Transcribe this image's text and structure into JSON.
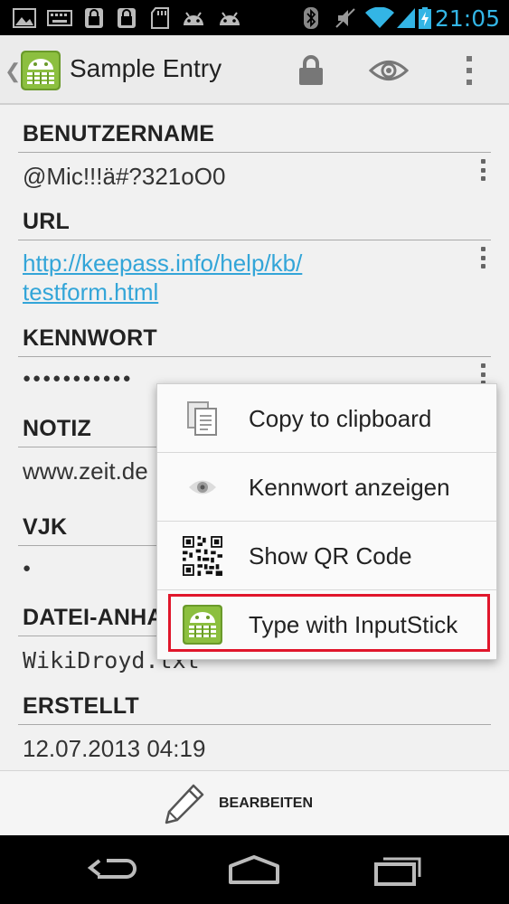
{
  "status_bar": {
    "time": "21:05",
    "left_icons": [
      "image-icon",
      "keyboard-icon",
      "lock-icon",
      "lock-icon",
      "sdcard-icon",
      "android-icon",
      "android-icon"
    ],
    "right_icons": [
      "bluetooth-icon",
      "vibrate-off-icon",
      "wifi-icon",
      "signal-icon",
      "battery-charging-icon"
    ],
    "accent_color": "#33b5e5"
  },
  "action_bar": {
    "title": "Sample Entry",
    "actions": [
      "lock-icon",
      "eye-icon",
      "overflow-menu-icon"
    ]
  },
  "fields": [
    {
      "title": "BENUTZERNAME",
      "value": "@Mic!!!ä#?321oO0"
    },
    {
      "title": "URL",
      "link_line1": "http://keepass.info/help/kb/",
      "link_line2": "testform.html"
    },
    {
      "title": "KENNWORT",
      "value": "●●●●●●●●●●●"
    },
    {
      "title": "NOTIZ",
      "value": "www.zeit.de"
    },
    {
      "title": "VJK",
      "value": "●"
    },
    {
      "title": "DATEI-ANHA",
      "value": "WikiDroyd.txt"
    },
    {
      "title": "ERSTELLT",
      "value": "12.07.2013 04:19"
    }
  ],
  "popup_menu": {
    "items": [
      {
        "label": "Copy to clipboard",
        "icon": "copy-icon"
      },
      {
        "label": "Kennwort anzeigen",
        "icon": "eye-icon"
      },
      {
        "label": "Show QR Code",
        "icon": "qr-code-icon"
      },
      {
        "label": "Type with InputStick",
        "icon": "inputstick-icon",
        "highlighted": true
      }
    ],
    "highlight_color": "#e0162b"
  },
  "edit_bar": {
    "label": "BEARBEITEN",
    "icon": "pencil-icon"
  },
  "nav_bar": {
    "buttons": [
      "back-icon",
      "home-icon",
      "recent-apps-icon"
    ]
  }
}
